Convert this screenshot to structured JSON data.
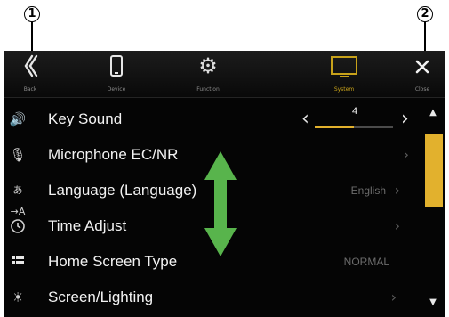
{
  "callouts": [
    "1",
    "2"
  ],
  "colors": {
    "accent": "#e2b12d",
    "arrow": "#58b44c",
    "background": "#050505"
  },
  "tabs": [
    {
      "name": "back",
      "label": "Back",
      "icon": "double-chevron-left-icon"
    },
    {
      "name": "device",
      "label": "Device",
      "icon": "phone-icon"
    },
    {
      "name": "function",
      "label": "Function",
      "icon": "gear-icon"
    },
    {
      "name": "system",
      "label": "System",
      "icon": "monitor-icon",
      "active": true
    },
    {
      "name": "close",
      "label": "Close",
      "icon": "close-icon"
    }
  ],
  "rows": [
    {
      "label": "Key Sound",
      "icon": "speaker-icon",
      "value": "4",
      "control": "stepper",
      "level": 0.5
    },
    {
      "label": "Microphone EC/NR",
      "icon": "microphone-icon",
      "value": "",
      "control": "chevron"
    },
    {
      "label": "Language (Language)",
      "icon": "language-icon",
      "value": "English",
      "control": "chevron"
    },
    {
      "label": "Time Adjust",
      "icon": "clock-icon",
      "value": "",
      "control": "chevron"
    },
    {
      "label": "Home Screen Type",
      "icon": "grid-icon",
      "value": "NORMAL",
      "control": "none"
    },
    {
      "label": "Screen/Lighting",
      "icon": "brightness-icon",
      "value": "",
      "control": "chevron"
    }
  ],
  "stepper": {
    "left": "‹",
    "right": "›"
  },
  "chevron": "›",
  "scroll": {
    "up": "▲",
    "down": "▼"
  }
}
